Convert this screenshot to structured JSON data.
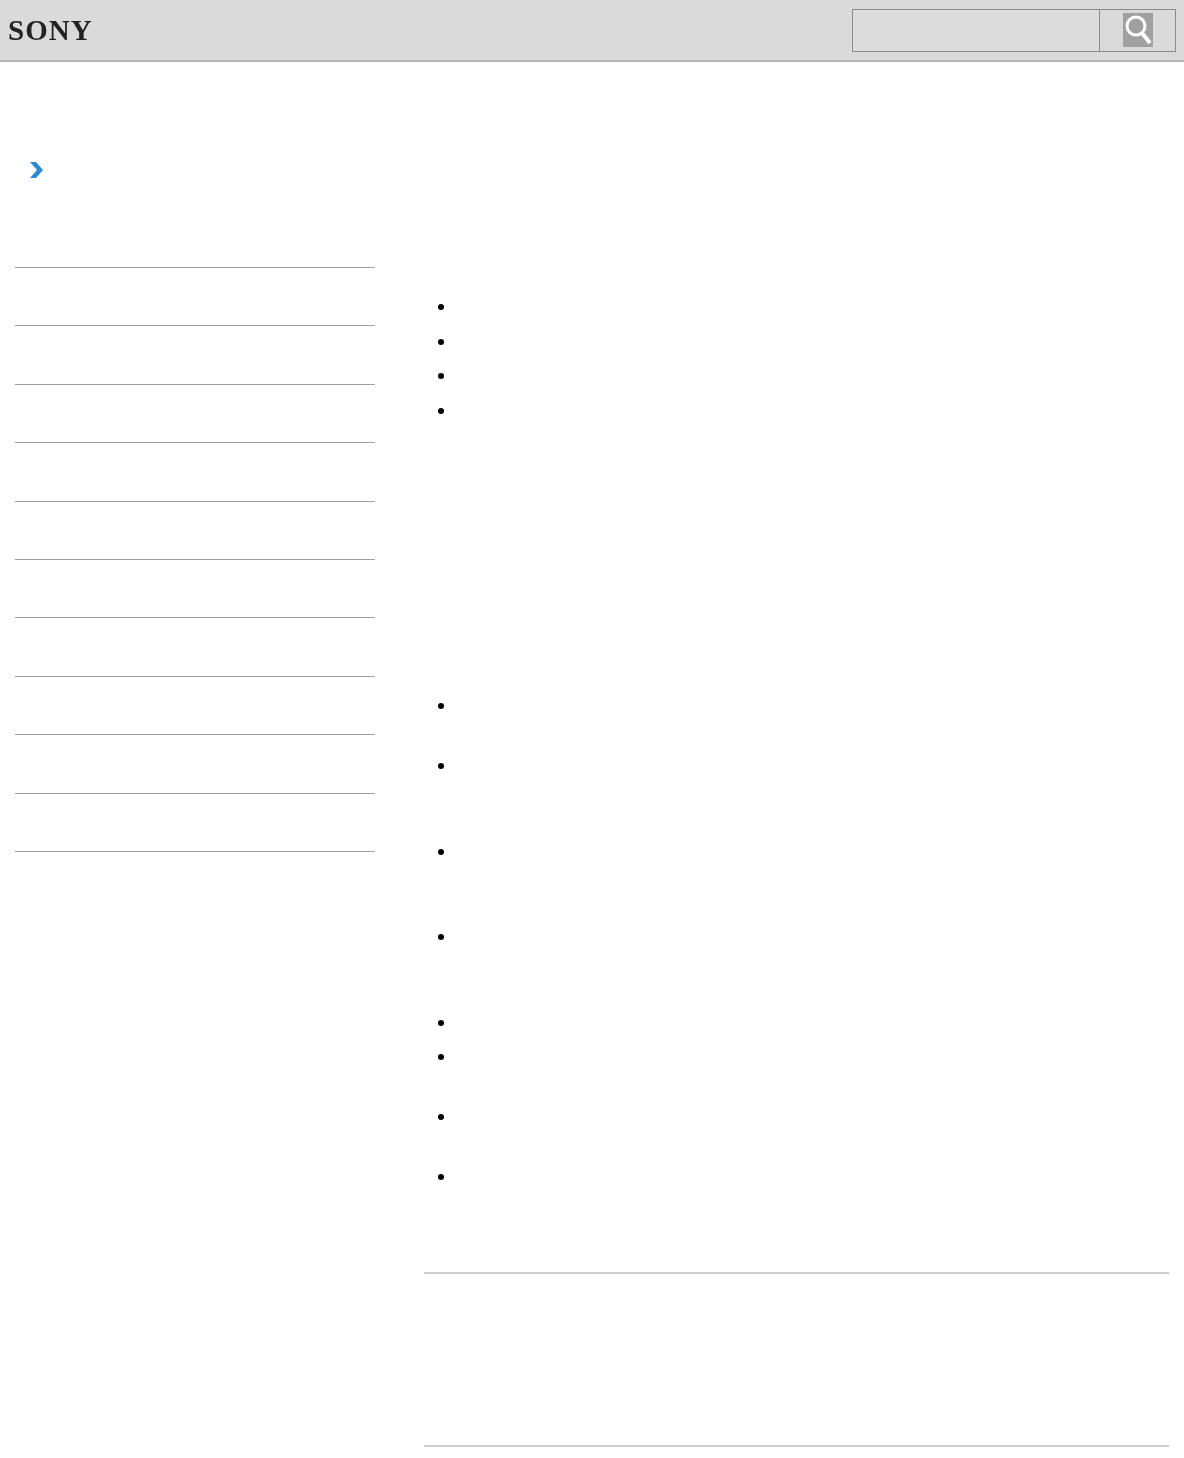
{
  "header": {
    "logo": "SONY"
  },
  "top_list": [
    {
      "kind": "short"
    },
    {
      "kind": "short"
    },
    {
      "kind": "short"
    },
    {
      "kind": "short"
    }
  ],
  "bottom_list": [
    {
      "kind": "medium"
    },
    {
      "kind": "tall"
    },
    {
      "kind": "tall"
    },
    {
      "kind": "tall"
    },
    {
      "kind": "short"
    },
    {
      "kind": "medium"
    },
    {
      "kind": "medium"
    },
    {
      "kind": "medium"
    }
  ]
}
